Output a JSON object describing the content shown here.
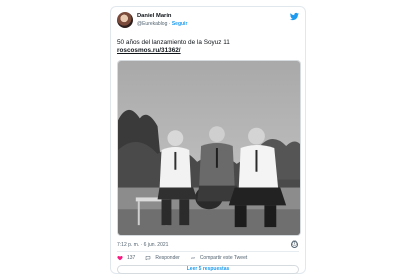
{
  "tweet": {
    "author": {
      "display_name": "Daniel Marín",
      "handle": "@Eurekablog",
      "separator": "·",
      "follow_label": "Seguir"
    },
    "text": "50 años del lanzamiento de la Soyuz 11",
    "link_text": "roscosmos.ru/31362/",
    "timestamp": "7:12 p. m. · 6 jun. 2021",
    "info_icon": "ⓘ",
    "actions": {
      "like_count": "137",
      "reply_label": "Responder",
      "share_label": "Compartir este Tweet"
    },
    "read_replies_label": "Leer 5 respuestas"
  },
  "icons": {
    "brand": "twitter-bird-icon",
    "like": "heart-icon",
    "reply": "speech-bubble-icon",
    "share": "link-icon",
    "info": "info-icon"
  },
  "colors": {
    "accent": "#1d9bf0",
    "like": "#f91880",
    "text": "#0f1419",
    "muted": "#536471"
  }
}
